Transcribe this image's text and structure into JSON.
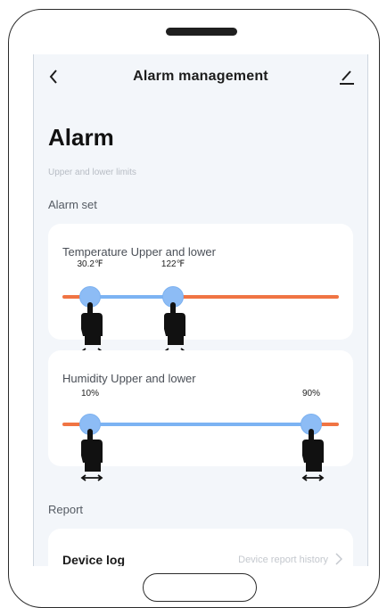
{
  "nav": {
    "title": "Alarm management",
    "back_icon": "chevron-left-icon",
    "edit_icon": "pencil-icon"
  },
  "page": {
    "title": "Alarm",
    "subtitle": "Upper and lower limits",
    "alarm_set_label": "Alarm set",
    "report_label": "Report"
  },
  "temperature": {
    "title": "Temperature Upper and lower",
    "low_label": "30.2℉",
    "high_label": "122℉",
    "low_fraction": 0.1,
    "high_fraction": 0.4
  },
  "humidity": {
    "title": "Humidity Upper and lower",
    "low_label": "10%",
    "high_label": "90%",
    "low_fraction": 0.1,
    "high_fraction": 0.9
  },
  "device_log": {
    "title": "Device log",
    "link": "Device report history"
  },
  "colors": {
    "range_active": "#7cb3f3",
    "range_outside": "#f07443",
    "knob": "#8dbcf5"
  }
}
